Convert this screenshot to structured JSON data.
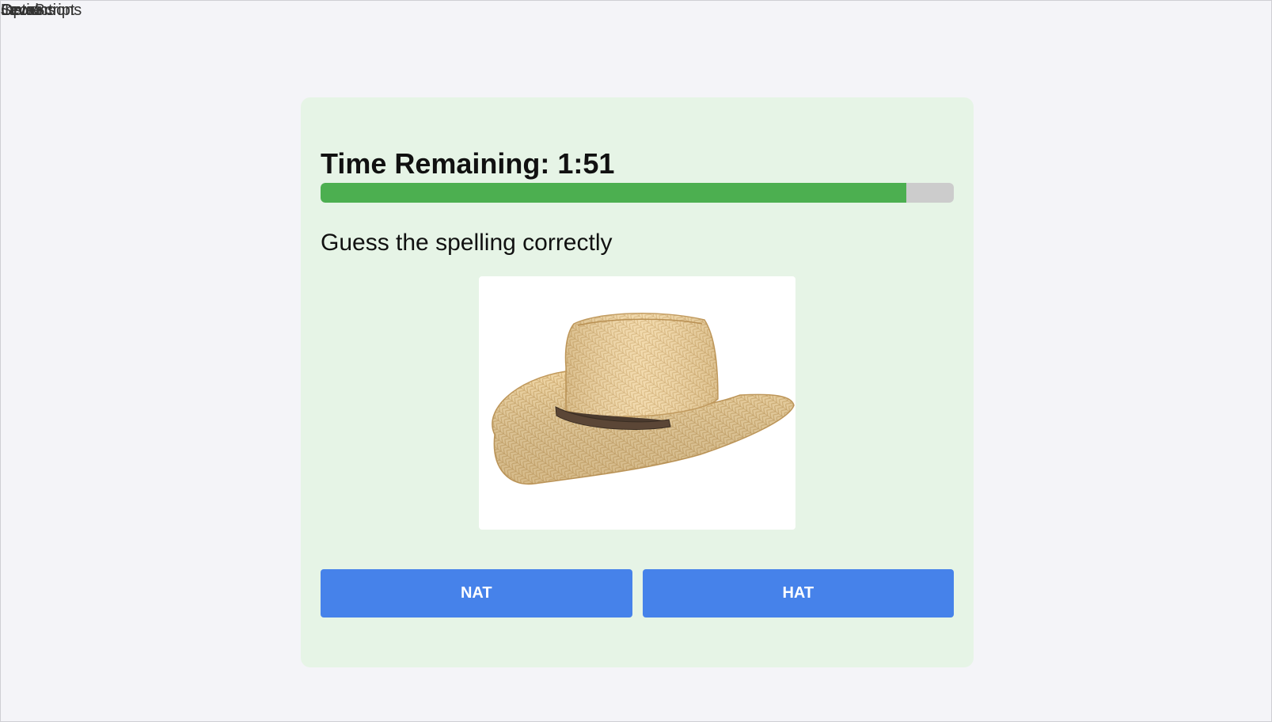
{
  "overlap_labels": [
    "Instructions",
    "Options",
    "Level",
    "Score",
    "JavaScript"
  ],
  "timer": {
    "label": "Time Remaining: 1:51",
    "progress_fraction": 0.925,
    "fill_color": "#4caf50",
    "track_color": "#cccccc"
  },
  "prompt": "Guess the spelling correctly",
  "image": {
    "icon": "straw-cowboy-hat-icon"
  },
  "options": [
    {
      "label": "NAT"
    },
    {
      "label": "HAT"
    }
  ],
  "colors": {
    "card_background": "#e6f4e6",
    "button": "#4682ea"
  }
}
